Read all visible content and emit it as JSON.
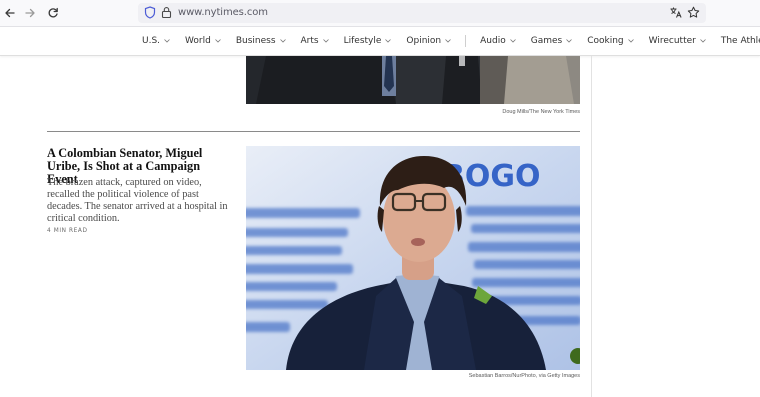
{
  "browser": {
    "url": "www.nytimes.com",
    "icons": [
      "back-arrow-icon",
      "forward-arrow-icon",
      "reload-icon",
      "shield-icon",
      "lock-icon",
      "translate-icon",
      "star-icon"
    ]
  },
  "nav": {
    "items": [
      {
        "label": "U.S."
      },
      {
        "label": "World"
      },
      {
        "label": "Business"
      },
      {
        "label": "Arts"
      },
      {
        "label": "Lifestyle"
      },
      {
        "label": "Opinion"
      },
      {
        "label": "Audio"
      },
      {
        "label": "Games"
      },
      {
        "label": "Cooking"
      },
      {
        "label": "Wirecutter"
      },
      {
        "label": "The Athletic"
      }
    ]
  },
  "top_image": {
    "credit": "Doug Mills/The New York Times"
  },
  "story": {
    "headline": "A Colombian Senator, Miguel Uribe, Is Shot at a Campaign Event",
    "summary": "The brazen attack, captured on video, recalled the political violence of past decades. The senator arrived at a hospital in critical condition.",
    "read_time": "4 MIN READ",
    "image_credit": "Sebastian Barros/NurPhoto, via Getty Images",
    "backdrop_word": "BOGO"
  },
  "colors": {
    "text": "#121212",
    "summary": "#4a4a4a",
    "rule": "#8a8a8a",
    "url_bar": "#f0f0f4"
  }
}
